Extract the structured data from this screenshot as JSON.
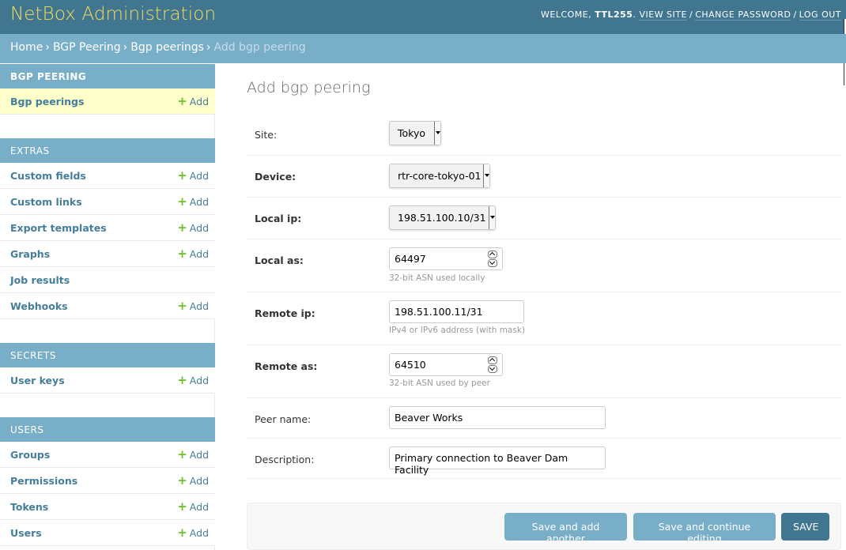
{
  "header": {
    "site_title": "NetBox Administration",
    "welcome": "WELCOME,",
    "username": "TTL255",
    "view_site": "VIEW SITE",
    "change_password": "CHANGE PASSWORD",
    "log_out": "LOG OUT",
    "sep": "/"
  },
  "breadcrumbs": {
    "items": [
      "Home",
      "BGP Peering",
      "Bgp peerings"
    ],
    "current": "Add bgp peering",
    "sep": "›"
  },
  "sidebar": {
    "modules": [
      {
        "caption": "BGP Peering",
        "rows": [
          {
            "name": "Bgp peerings",
            "add": "Add"
          }
        ]
      },
      {
        "caption": "Extras",
        "rows": [
          {
            "name": "Custom fields",
            "add": "Add"
          },
          {
            "name": "Custom links",
            "add": "Add"
          },
          {
            "name": "Export templates",
            "add": "Add"
          },
          {
            "name": "Graphs",
            "add": "Add"
          },
          {
            "name": "Job results",
            "add": ""
          },
          {
            "name": "Webhooks",
            "add": "Add"
          }
        ]
      },
      {
        "caption": "Secrets",
        "rows": [
          {
            "name": "User keys",
            "add": "Add"
          }
        ]
      },
      {
        "caption": "Users",
        "rows": [
          {
            "name": "Groups",
            "add": "Add"
          },
          {
            "name": "Permissions",
            "add": "Add"
          },
          {
            "name": "Tokens",
            "add": "Add"
          },
          {
            "name": "Users",
            "add": "Add"
          }
        ]
      }
    ]
  },
  "content": {
    "title": "Add bgp peering",
    "fields": {
      "site": {
        "label": "Site:",
        "value": "Tokyo"
      },
      "device": {
        "label": "Device:",
        "value": "rtr-core-tokyo-01"
      },
      "local_ip": {
        "label": "Local ip:",
        "value": "198.51.100.10/31"
      },
      "local_as": {
        "label": "Local as:",
        "value": "64497",
        "help": "32-bit ASN used locally"
      },
      "remote_ip": {
        "label": "Remote ip:",
        "value": "198.51.100.11/31",
        "help": "IPv4 or IPv6 address (with mask)"
      },
      "remote_as": {
        "label": "Remote as:",
        "value": "64510",
        "help": "32-bit ASN used by peer"
      },
      "peer_name": {
        "label": "Peer name:",
        "value": "Beaver Works"
      },
      "description": {
        "label": "Description:",
        "value": "Primary connection to Beaver Dam Facility"
      }
    }
  },
  "submit": {
    "save_add_another": "Save and add another",
    "save_continue": "Save and continue editing",
    "save": "SAVE"
  },
  "colors": {
    "header_bg": "#417690",
    "brand": "#f5dd5d",
    "breadcrumb_bg": "#79aec8",
    "link": "#447e9b",
    "add_plus": "#70bf2b",
    "selected_row": "#ffffcc"
  }
}
